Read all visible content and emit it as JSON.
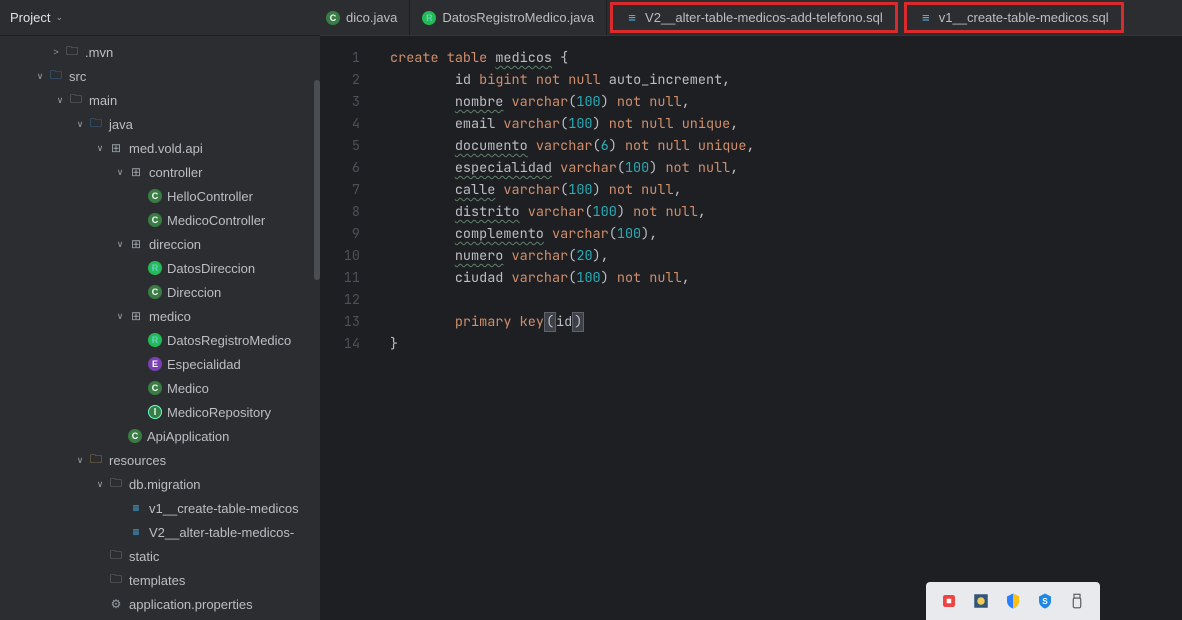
{
  "sidebar": {
    "title": "Project",
    "tree": [
      {
        "indent": 48,
        "arrow": ">",
        "iconClass": "folder",
        "icon": "🗀",
        "label": ".mvn",
        "int": "true",
        "name": "tree-mvn"
      },
      {
        "indent": 32,
        "arrow": "∨",
        "iconClass": "folder-src",
        "icon": "🗀",
        "label": "src",
        "int": "true",
        "name": "tree-src"
      },
      {
        "indent": 52,
        "arrow": "∨",
        "iconClass": "folder",
        "icon": "🗀",
        "label": "main",
        "int": "true",
        "name": "tree-main"
      },
      {
        "indent": 72,
        "arrow": "∨",
        "iconClass": "folder-java",
        "icon": "🗀",
        "label": "java",
        "int": "true",
        "name": "tree-java"
      },
      {
        "indent": 92,
        "arrow": "∨",
        "iconClass": "pkg",
        "icon": "⊞",
        "label": "med.vold.api",
        "int": "true",
        "name": "tree-pkg-api"
      },
      {
        "indent": 112,
        "arrow": "∨",
        "iconClass": "pkg",
        "icon": "⊞",
        "label": "controller",
        "int": "true",
        "name": "tree-pkg-controller"
      },
      {
        "indent": 132,
        "arrow": "",
        "iconClass": "class-c",
        "icon": "C",
        "label": "HelloController",
        "int": "true",
        "name": "tree-hello"
      },
      {
        "indent": 132,
        "arrow": "",
        "iconClass": "class-c",
        "icon": "C",
        "label": "MedicoController",
        "int": "true",
        "name": "tree-medicocontroller"
      },
      {
        "indent": 112,
        "arrow": "∨",
        "iconClass": "pkg",
        "icon": "⊞",
        "label": "direccion",
        "int": "true",
        "name": "tree-pkg-direccion"
      },
      {
        "indent": 132,
        "arrow": "",
        "iconClass": "class-r",
        "icon": "R",
        "label": "DatosDireccion",
        "int": "true",
        "name": "tree-datosdireccion"
      },
      {
        "indent": 132,
        "arrow": "",
        "iconClass": "class-c",
        "icon": "C",
        "label": "Direccion",
        "int": "true",
        "name": "tree-direccion"
      },
      {
        "indent": 112,
        "arrow": "∨",
        "iconClass": "pkg",
        "icon": "⊞",
        "label": "medico",
        "int": "true",
        "name": "tree-pkg-medico"
      },
      {
        "indent": 132,
        "arrow": "",
        "iconClass": "class-r",
        "icon": "R",
        "label": "DatosRegistroMedico",
        "int": "true",
        "name": "tree-datosregistro"
      },
      {
        "indent": 132,
        "arrow": "",
        "iconClass": "class-e",
        "icon": "E",
        "label": "Especialidad",
        "int": "true",
        "name": "tree-especialidad"
      },
      {
        "indent": 132,
        "arrow": "",
        "iconClass": "class-c",
        "icon": "C",
        "label": "Medico",
        "int": "true",
        "name": "tree-medico"
      },
      {
        "indent": 132,
        "arrow": "",
        "iconClass": "class-i",
        "icon": "I",
        "label": "MedicoRepository",
        "int": "true",
        "name": "tree-repo"
      },
      {
        "indent": 112,
        "arrow": "",
        "iconClass": "class-c",
        "icon": "C",
        "label": "ApiApplication",
        "int": "true",
        "name": "tree-apiapp"
      },
      {
        "indent": 72,
        "arrow": "∨",
        "iconClass": "resfolder",
        "icon": "🗀",
        "label": "resources",
        "int": "true",
        "name": "tree-resources"
      },
      {
        "indent": 92,
        "arrow": "∨",
        "iconClass": "folder",
        "icon": "🗀",
        "label": "db.migration",
        "int": "true",
        "name": "tree-dbmigration"
      },
      {
        "indent": 112,
        "arrow": "",
        "iconClass": "sql-ico",
        "icon": "≡",
        "label": "v1__create-table-medicos",
        "int": "true",
        "name": "tree-v1sql"
      },
      {
        "indent": 112,
        "arrow": "",
        "iconClass": "sql-ico",
        "icon": "≡",
        "label": "V2__alter-table-medicos-",
        "int": "true",
        "name": "tree-v2sql"
      },
      {
        "indent": 92,
        "arrow": "",
        "iconClass": "folder",
        "icon": "🗀",
        "label": "static",
        "int": "true",
        "name": "tree-static"
      },
      {
        "indent": 92,
        "arrow": "",
        "iconClass": "folder",
        "icon": "🗀",
        "label": "templates",
        "int": "true",
        "name": "tree-templates"
      },
      {
        "indent": 92,
        "arrow": "",
        "iconClass": "gear",
        "icon": "⚙",
        "label": "application.properties",
        "int": "true",
        "name": "tree-appprops"
      }
    ]
  },
  "tabs": [
    {
      "label": "dico.java",
      "icon": "C",
      "iconClass": "class-c",
      "partial": true,
      "highlight": false,
      "name": "tab-dico"
    },
    {
      "label": "DatosRegistroMedico.java",
      "icon": "R",
      "iconClass": "class-r",
      "partial": false,
      "highlight": false,
      "name": "tab-datosregistro"
    },
    {
      "label": "V2__alter-table-medicos-add-telefono.sql",
      "icon": "≡",
      "iconClass": "sql-ico",
      "partial": false,
      "highlight": true,
      "name": "tab-v2sql"
    },
    {
      "label": "v1__create-table-medicos.sql",
      "icon": "≡",
      "iconClass": "sql-ico",
      "partial": false,
      "highlight": true,
      "name": "tab-v1sql"
    }
  ],
  "code": {
    "lines": [
      1,
      2,
      3,
      4,
      5,
      6,
      7,
      8,
      9,
      10,
      11,
      12,
      13,
      14
    ],
    "l1_a": "create",
    "l1_b": "table",
    "l1_c": "medicos",
    "l1_d": "{",
    "l2_a": "id",
    "l2_b": "bigint",
    "l2_c": "not",
    "l2_d": "null",
    "l2_e": "auto_increment,",
    "l3_a": "nombre",
    "l3_b": "varchar",
    "l3_c": "100",
    "l3_d": "not",
    "l3_e": "null",
    "l4_a": "email",
    "l4_b": "varchar",
    "l4_c": "100",
    "l4_d": "not",
    "l4_e": "null",
    "l4_f": "unique",
    "l5_a": "documento",
    "l5_b": "varchar",
    "l5_c": "6",
    "l5_d": "not",
    "l5_e": "null",
    "l5_f": "unique",
    "l6_a": "especialidad",
    "l6_b": "varchar",
    "l6_c": "100",
    "l6_d": "not",
    "l6_e": "null",
    "l7_a": "calle",
    "l7_b": "varchar",
    "l7_c": "100",
    "l7_d": "not",
    "l7_e": "null",
    "l8_a": "distrito",
    "l8_b": "varchar",
    "l8_c": "100",
    "l8_d": "not",
    "l8_e": "null",
    "l9_a": "complemento",
    "l9_b": "varchar",
    "l9_c": "100",
    "l10_a": "numero",
    "l10_b": "varchar",
    "l10_c": "20",
    "l11_a": "ciudad",
    "l11_b": "varchar",
    "l11_c": "100",
    "l11_d": "not",
    "l11_e": "null",
    "l13_a": "primary",
    "l13_b": "key",
    "l13_c": "id",
    "l14_a": "}"
  }
}
